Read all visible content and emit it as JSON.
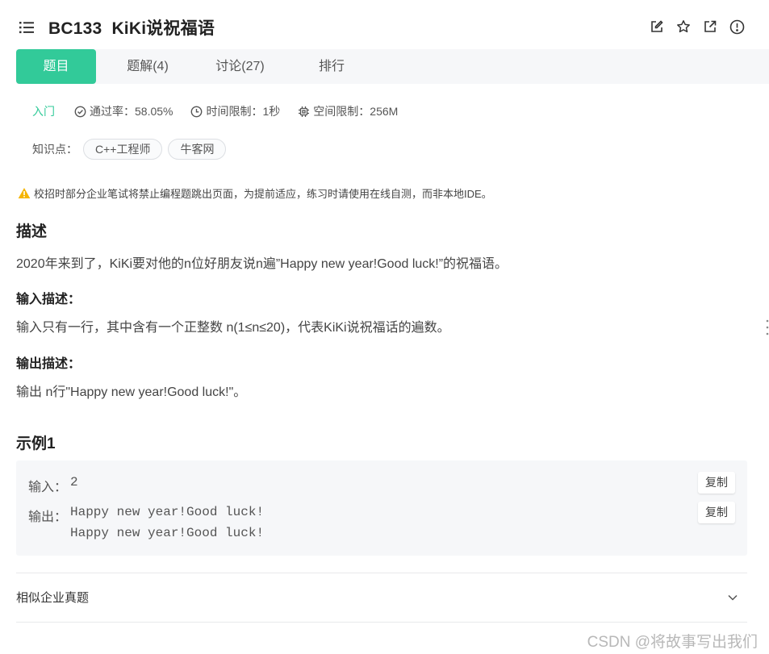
{
  "header": {
    "title": "BC133  KiKi说祝福语",
    "tools": [
      "edit-icon",
      "star-icon",
      "external-link-icon",
      "info-icon"
    ]
  },
  "tabs": [
    {
      "label": "题目",
      "active": true
    },
    {
      "label": "题解(4)",
      "active": false
    },
    {
      "label": "讨论(27)",
      "active": false
    },
    {
      "label": "排行",
      "active": false
    }
  ],
  "meta": {
    "level": "入门",
    "pass_rate": "通过率：58.05%",
    "time_limit": "时间限制：1秒",
    "memory_limit": "空间限制：256M"
  },
  "knowledge": {
    "label": "知识点：",
    "tags": [
      "C++工程师",
      "牛客网"
    ]
  },
  "notice": "校招时部分企业笔试将禁止编程题跳出页面，为提前适应，练习时请使用在线自测，而非本地IDE。",
  "description": {
    "heading": "描述",
    "text": "2020年来到了，KiKi要对他的n位好朋友说n遍”Happy new year!Good luck!”的祝福语。"
  },
  "input_desc": {
    "heading": "输入描述：",
    "text": "输入只有一行，其中含有一个正整数 n(1≤n≤20)，代表KiKi说祝福话的遍数。"
  },
  "output_desc": {
    "heading": "输出描述：",
    "text": "输出 n行\"Happy new year!Good luck!\"。"
  },
  "example": {
    "heading": "示例1",
    "input_label": "输入：",
    "input_value": "2",
    "output_label": "输出：",
    "output_value": "Happy new year!Good luck!\nHappy new year!Good luck!",
    "copy_label": "复制"
  },
  "similar": {
    "label": "相似企业真题"
  },
  "watermark": "CSDN @将故事写出我们",
  "colors": {
    "accent": "#32ca99",
    "tab_bg": "#f6f7f9",
    "warning": "#f5b400"
  }
}
